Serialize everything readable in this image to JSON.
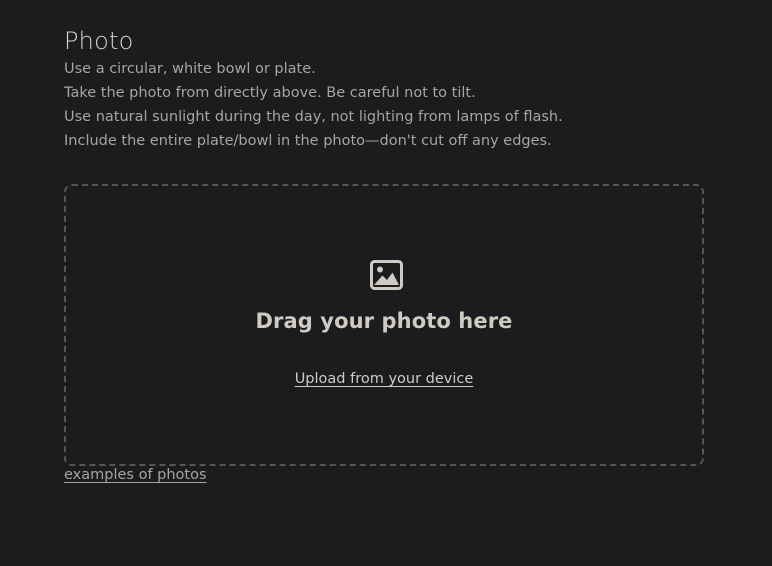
{
  "photo_section": {
    "title": "Photo",
    "instructions": [
      "Use a circular, white bowl or plate.",
      "Take the photo from directly above. Be careful not to tilt.",
      "Use natural sunlight during the day, not lighting from lamps of flash.",
      "Include the entire plate/bowl in the photo—don't cut off any edges."
    ]
  },
  "dropzone": {
    "icon": "image-icon",
    "heading": "Drag your photo here",
    "upload_link": "Upload from your device"
  },
  "examples_link": "examples of photos",
  "colors": {
    "background": "#1b1c1e",
    "text": "#a9a49c",
    "heading": "#d6d2cc",
    "dropzone_border": "#55565a"
  }
}
